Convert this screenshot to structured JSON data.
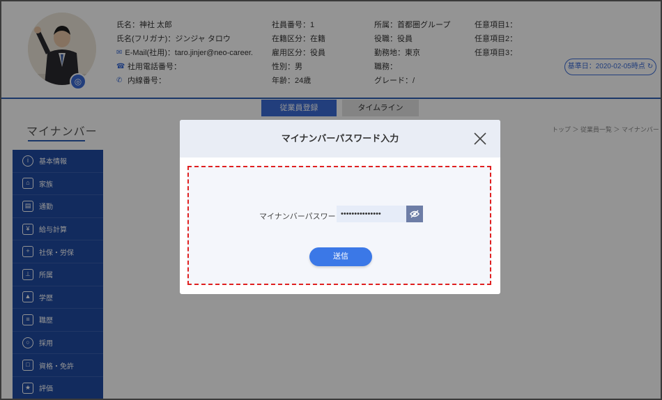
{
  "header": {
    "col1": [
      {
        "label": "氏名：神社 太郎",
        "icon": ""
      },
      {
        "label": "氏名(フリガナ)：ジンジャ タロウ",
        "icon": ""
      },
      {
        "label": "E-Mail(社用)：taro.jinjer@neo-career.c...",
        "icon": "mail-icon"
      },
      {
        "label": "社用電話番号：",
        "icon": "phone-icon"
      },
      {
        "label": "内線番号：",
        "icon": "extension-phone-icon"
      }
    ],
    "col2": [
      "社員番号：1",
      "在籍区分：在籍",
      "雇用区分：役員",
      "性別：男",
      "年齢：24歳"
    ],
    "col3": [
      "所属：首都圏グループ",
      "役職：役員",
      "勤務地：東京",
      "職務：",
      "グレード：/"
    ],
    "col4": [
      "任意項目1：",
      "任意項目2：",
      "任意項目3："
    ],
    "base_date": "基準日：2020-02-05時点"
  },
  "tabs": {
    "register": "従業員登録",
    "timeline": "タイムライン"
  },
  "page": {
    "title": "マイナンバー",
    "breadcrumb": "トップ ＞ 従業員一覧 ＞ マイナンバー"
  },
  "sidebar": {
    "items": [
      {
        "label": "基本情報",
        "icon": "info-icon"
      },
      {
        "label": "家族",
        "icon": "family-icon"
      },
      {
        "label": "通勤",
        "icon": "train-icon"
      },
      {
        "label": "給与計算",
        "icon": "yen-icon"
      },
      {
        "label": "社保・労保",
        "icon": "insurance-icon"
      },
      {
        "label": "所属",
        "icon": "org-icon"
      },
      {
        "label": "学歴",
        "icon": "graduation-icon"
      },
      {
        "label": "職歴",
        "icon": "career-icon"
      },
      {
        "label": "採用",
        "icon": "recruit-icon"
      },
      {
        "label": "資格・免許",
        "icon": "license-icon"
      },
      {
        "label": "評価",
        "icon": "evaluation-icon"
      }
    ]
  },
  "modal": {
    "title": "マイナンバーパスワード入力",
    "password_label": "マイナンバーパスワード",
    "password_value": "•••••••••••••••",
    "submit_label": "送信"
  },
  "colors": {
    "primary": "#3b6cd6",
    "sidebar": "#1f4aa3",
    "highlight_border": "#e02020"
  }
}
